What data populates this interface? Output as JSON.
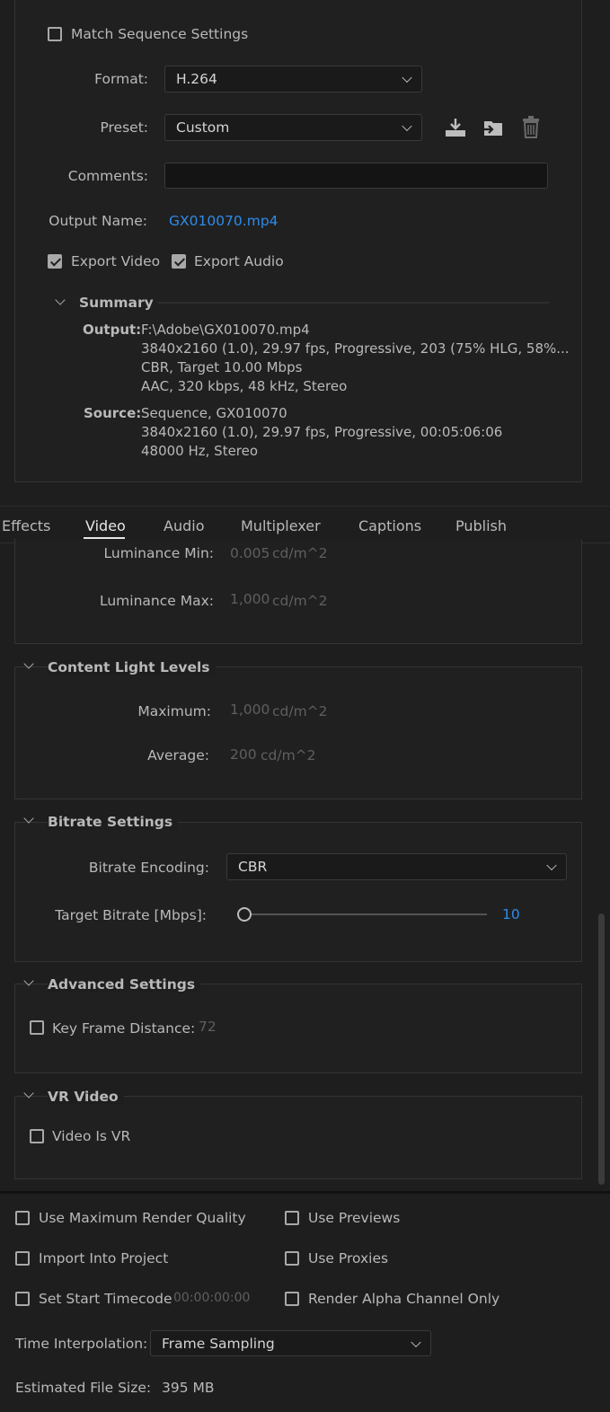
{
  "top": {
    "match_sequence": "Match Sequence Settings",
    "format_label": "Format:",
    "format_value": "H.264",
    "preset_label": "Preset:",
    "preset_value": "Custom",
    "comments_label": "Comments:",
    "comments_value": "",
    "output_name_label": "Output Name:",
    "output_name_value": "GX010070.mp4",
    "export_video": "Export Video",
    "export_audio": "Export Audio"
  },
  "summary": {
    "title": "Summary",
    "output_label": "Output:",
    "output_lines": [
      "F:\\Adobe\\GX010070.mp4",
      "3840x2160 (1.0), 29.97 fps, Progressive, 203 (75% HLG, 58%...",
      "CBR, Target 10.00 Mbps",
      "AAC, 320 kbps, 48 kHz, Stereo"
    ],
    "source_label": "Source:",
    "source_lines": [
      "Sequence, GX010070",
      "3840x2160 (1.0), 29.97 fps, Progressive, 00:05:06:06",
      "48000 Hz, Stereo"
    ]
  },
  "tabs": [
    "Effects",
    "Video",
    "Audio",
    "Multiplexer",
    "Captions",
    "Publish"
  ],
  "active_tab": "Video",
  "luminance": {
    "min_label": "Luminance Min:",
    "min_value": "0.005",
    "min_unit": "cd/m^2",
    "max_label": "Luminance Max:",
    "max_value": "1,000",
    "max_unit": "cd/m^2"
  },
  "content_light": {
    "title": "Content Light Levels",
    "maximum_label": "Maximum:",
    "maximum_value": "1,000",
    "maximum_unit": "cd/m^2",
    "average_label": "Average:",
    "average_value": "200",
    "average_unit": "cd/m^2"
  },
  "bitrate": {
    "title": "Bitrate Settings",
    "encoding_label": "Bitrate Encoding:",
    "encoding_value": "CBR",
    "target_label": "Target Bitrate [Mbps]:",
    "target_value": "10",
    "target_fraction": 0.0
  },
  "advanced": {
    "title": "Advanced Settings",
    "keyframe_label": "Key Frame Distance:",
    "keyframe_value": "72"
  },
  "vr": {
    "title": "VR Video",
    "video_is_vr": "Video Is VR"
  },
  "bottom": {
    "use_max_render": "Use Maximum Render Quality",
    "use_previews": "Use Previews",
    "import_into_project": "Import Into Project",
    "use_proxies": "Use Proxies",
    "set_start_timecode": "Set Start Timecode",
    "timecode_value": "00:00:00:00",
    "render_alpha": "Render Alpha Channel Only",
    "time_interp_label": "Time Interpolation:",
    "time_interp_value": "Frame Sampling",
    "est_size_label": "Estimated File Size:",
    "est_size_value": "395 MB"
  },
  "colors": {
    "accent": "#2d8ceb",
    "background": "#1e1e1e",
    "text": "#b9b9b9"
  }
}
